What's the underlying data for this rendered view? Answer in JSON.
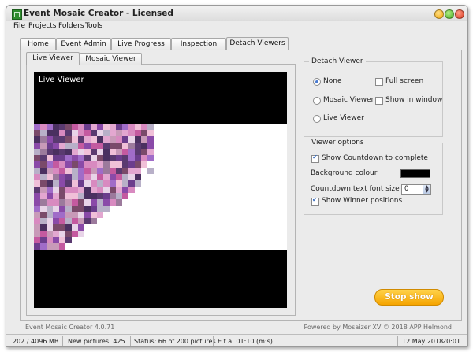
{
  "window": {
    "title": "Event Mosaic Creator - Licensed"
  },
  "menu": [
    "File",
    "Projects",
    "Folders",
    "Tools"
  ],
  "main_tabs": [
    "Home",
    "Event Admin",
    "Live Progress",
    "Inspection",
    "Detach Viewers"
  ],
  "sub_tabs": [
    "Live Viewer",
    "Mosaic Viewer"
  ],
  "viewer": {
    "label": "Live Viewer"
  },
  "detach_viewer": {
    "title": "Detach Viewer",
    "options": [
      {
        "label": "None",
        "selected": true
      },
      {
        "label": "Mosaic Viewer",
        "selected": false
      },
      {
        "label": "Live Viewer",
        "selected": false
      }
    ],
    "full_screen": {
      "label": "Full screen",
      "checked": false
    },
    "show_in_window": {
      "label": "Show in window",
      "checked": false
    }
  },
  "viewer_options": {
    "title": "Viewer options",
    "show_countdown": {
      "label": "Show Countdown to complete",
      "checked": true
    },
    "background_colour": {
      "label": "Background colour",
      "value": "#000000"
    },
    "countdown_font_size": {
      "label": "Countdown text font size",
      "value": "0"
    },
    "show_winner": {
      "label": "Show Winner positions",
      "checked": true
    }
  },
  "stop_button": "Stop show",
  "footer": {
    "version": "Event Mosaic Creator 4.0.71",
    "powered": "Powered by Mosaizer XV © 2018  APP Helmond"
  },
  "status": {
    "memory": "202 / 4096 MB",
    "new_pictures": "New pictures: 425",
    "status": "Status: 66 of 200 pictures",
    "eta": "E.t.a: 01:10 (m:s)",
    "date": "12 May 2018",
    "time": "20:01"
  },
  "colors": {
    "accent": "#f5a400",
    "title_icon": "#2e8b2e"
  }
}
